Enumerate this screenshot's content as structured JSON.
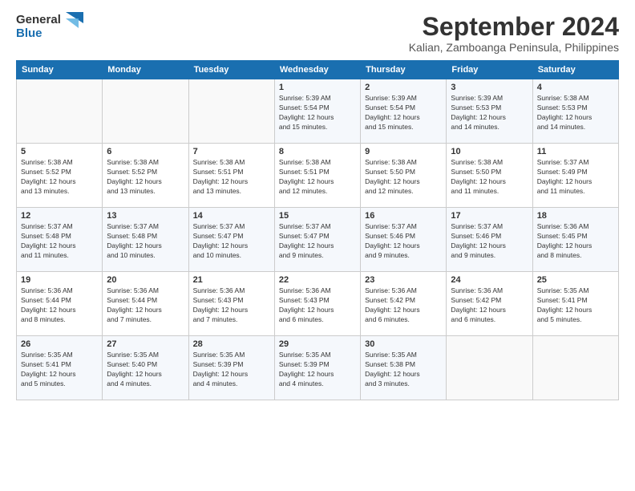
{
  "header": {
    "logo_line1": "General",
    "logo_line2": "Blue",
    "month": "September 2024",
    "location": "Kalian, Zamboanga Peninsula, Philippines"
  },
  "weekdays": [
    "Sunday",
    "Monday",
    "Tuesday",
    "Wednesday",
    "Thursday",
    "Friday",
    "Saturday"
  ],
  "days": [
    {
      "num": "",
      "info": ""
    },
    {
      "num": "",
      "info": ""
    },
    {
      "num": "",
      "info": ""
    },
    {
      "num": "1",
      "info": "Sunrise: 5:39 AM\nSunset: 5:54 PM\nDaylight: 12 hours\nand 15 minutes."
    },
    {
      "num": "2",
      "info": "Sunrise: 5:39 AM\nSunset: 5:54 PM\nDaylight: 12 hours\nand 15 minutes."
    },
    {
      "num": "3",
      "info": "Sunrise: 5:39 AM\nSunset: 5:53 PM\nDaylight: 12 hours\nand 14 minutes."
    },
    {
      "num": "4",
      "info": "Sunrise: 5:38 AM\nSunset: 5:53 PM\nDaylight: 12 hours\nand 14 minutes."
    },
    {
      "num": "5",
      "info": "Sunrise: 5:38 AM\nSunset: 5:52 PM\nDaylight: 12 hours\nand 13 minutes."
    },
    {
      "num": "6",
      "info": "Sunrise: 5:38 AM\nSunset: 5:52 PM\nDaylight: 12 hours\nand 13 minutes."
    },
    {
      "num": "7",
      "info": "Sunrise: 5:38 AM\nSunset: 5:51 PM\nDaylight: 12 hours\nand 13 minutes."
    },
    {
      "num": "8",
      "info": "Sunrise: 5:38 AM\nSunset: 5:51 PM\nDaylight: 12 hours\nand 12 minutes."
    },
    {
      "num": "9",
      "info": "Sunrise: 5:38 AM\nSunset: 5:50 PM\nDaylight: 12 hours\nand 12 minutes."
    },
    {
      "num": "10",
      "info": "Sunrise: 5:38 AM\nSunset: 5:50 PM\nDaylight: 12 hours\nand 11 minutes."
    },
    {
      "num": "11",
      "info": "Sunrise: 5:37 AM\nSunset: 5:49 PM\nDaylight: 12 hours\nand 11 minutes."
    },
    {
      "num": "12",
      "info": "Sunrise: 5:37 AM\nSunset: 5:48 PM\nDaylight: 12 hours\nand 11 minutes."
    },
    {
      "num": "13",
      "info": "Sunrise: 5:37 AM\nSunset: 5:48 PM\nDaylight: 12 hours\nand 10 minutes."
    },
    {
      "num": "14",
      "info": "Sunrise: 5:37 AM\nSunset: 5:47 PM\nDaylight: 12 hours\nand 10 minutes."
    },
    {
      "num": "15",
      "info": "Sunrise: 5:37 AM\nSunset: 5:47 PM\nDaylight: 12 hours\nand 9 minutes."
    },
    {
      "num": "16",
      "info": "Sunrise: 5:37 AM\nSunset: 5:46 PM\nDaylight: 12 hours\nand 9 minutes."
    },
    {
      "num": "17",
      "info": "Sunrise: 5:37 AM\nSunset: 5:46 PM\nDaylight: 12 hours\nand 9 minutes."
    },
    {
      "num": "18",
      "info": "Sunrise: 5:36 AM\nSunset: 5:45 PM\nDaylight: 12 hours\nand 8 minutes."
    },
    {
      "num": "19",
      "info": "Sunrise: 5:36 AM\nSunset: 5:44 PM\nDaylight: 12 hours\nand 8 minutes."
    },
    {
      "num": "20",
      "info": "Sunrise: 5:36 AM\nSunset: 5:44 PM\nDaylight: 12 hours\nand 7 minutes."
    },
    {
      "num": "21",
      "info": "Sunrise: 5:36 AM\nSunset: 5:43 PM\nDaylight: 12 hours\nand 7 minutes."
    },
    {
      "num": "22",
      "info": "Sunrise: 5:36 AM\nSunset: 5:43 PM\nDaylight: 12 hours\nand 6 minutes."
    },
    {
      "num": "23",
      "info": "Sunrise: 5:36 AM\nSunset: 5:42 PM\nDaylight: 12 hours\nand 6 minutes."
    },
    {
      "num": "24",
      "info": "Sunrise: 5:36 AM\nSunset: 5:42 PM\nDaylight: 12 hours\nand 6 minutes."
    },
    {
      "num": "25",
      "info": "Sunrise: 5:35 AM\nSunset: 5:41 PM\nDaylight: 12 hours\nand 5 minutes."
    },
    {
      "num": "26",
      "info": "Sunrise: 5:35 AM\nSunset: 5:41 PM\nDaylight: 12 hours\nand 5 minutes."
    },
    {
      "num": "27",
      "info": "Sunrise: 5:35 AM\nSunset: 5:40 PM\nDaylight: 12 hours\nand 4 minutes."
    },
    {
      "num": "28",
      "info": "Sunrise: 5:35 AM\nSunset: 5:39 PM\nDaylight: 12 hours\nand 4 minutes."
    },
    {
      "num": "29",
      "info": "Sunrise: 5:35 AM\nSunset: 5:39 PM\nDaylight: 12 hours\nand 4 minutes."
    },
    {
      "num": "30",
      "info": "Sunrise: 5:35 AM\nSunset: 5:38 PM\nDaylight: 12 hours\nand 3 minutes."
    },
    {
      "num": "",
      "info": ""
    },
    {
      "num": "",
      "info": ""
    },
    {
      "num": "",
      "info": ""
    },
    {
      "num": "",
      "info": ""
    },
    {
      "num": "",
      "info": ""
    }
  ]
}
